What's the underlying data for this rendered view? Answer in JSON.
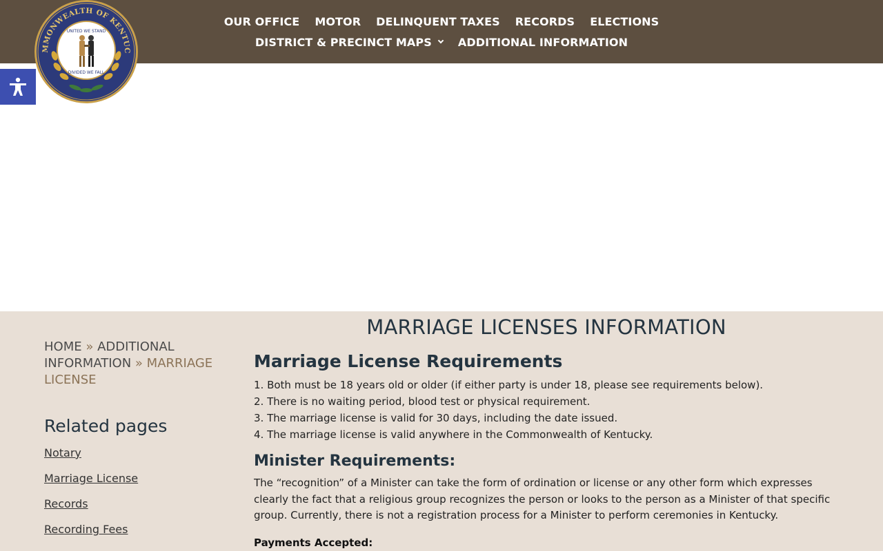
{
  "header": {
    "nav_row1": [
      {
        "label": "OUR OFFICE"
      },
      {
        "label": "MOTOR"
      },
      {
        "label": "DELINQUENT TAXES"
      },
      {
        "label": "RECORDS"
      },
      {
        "label": "ELECTIONS"
      }
    ],
    "nav_row2": [
      {
        "label": "DISTRICT & PRECINCT MAPS",
        "dropdown": true
      },
      {
        "label": "ADDITIONAL INFORMATION"
      }
    ],
    "seal_text_top": "COMMONWEALTH OF KENTUCKY",
    "seal_text_inner_top": "UNITED WE STAND",
    "seal_text_inner_bottom": "DIVIDED WE FALL",
    "colors": {
      "header_bg": "#5d4f40",
      "accent": "#8b7357",
      "a11y": "#3d4fb0"
    }
  },
  "page": {
    "title": "MARRIAGE LICENSES INFORMATION"
  },
  "sidebar": {
    "breadcrumb": {
      "home": "HOME",
      "sep1": "»",
      "parent": "ADDITIONAL INFORMATION",
      "sep2": "»",
      "current": "MARRIAGE LICENSE"
    },
    "related_title": "Related pages",
    "related": [
      {
        "label": "Notary"
      },
      {
        "label": "Marriage License"
      },
      {
        "label": "Records"
      },
      {
        "label": "Recording Fees"
      }
    ]
  },
  "main": {
    "req_heading": "Marriage License Requirements",
    "requirements": [
      "1. Both must be 18 years old or older (if either party is under 18, please see requirements below).",
      "2. There is no waiting period, blood test or physical requirement.",
      "3. The marriage license is valid for 30 days, including the date issued.",
      "4. The marriage license is valid anywhere in the Commonwealth of Kentucky."
    ],
    "minister_heading": "Minister Requirements:",
    "minister_text": "The “recognition” of a Minister can take the form of ordination or license or any other form which expresses clearly the fact that a religious group recognizes the person or looks to the person as a Minister of that specific group. Currently, there is not a registration process for a Minister to perform ceremonies in Kentucky.",
    "payments_label": "Payments Accepted:"
  }
}
